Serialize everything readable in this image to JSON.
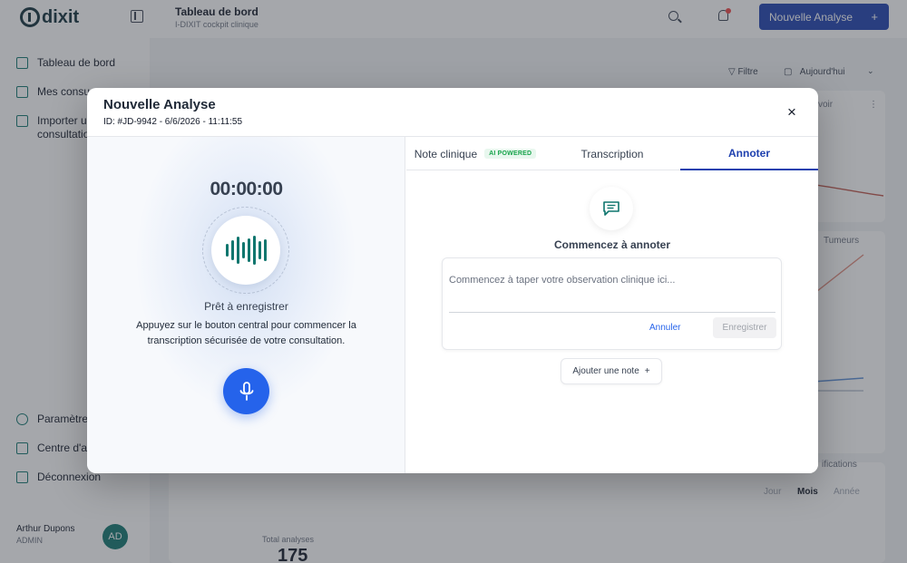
{
  "app": {
    "logo": "dixit",
    "header": {
      "title": "Tableau de bord",
      "subtitle": "I-DIXIT cockpit clinique"
    },
    "new_button": {
      "label": "Nouvelle Analyse",
      "plus": "+"
    },
    "accent_color": "#1e40af",
    "sidebar": {
      "items": [
        {
          "label": "Tableau de bord",
          "icon": "dashboard-icon"
        },
        {
          "label": "Mes consu",
          "icon": "calendar-icon"
        },
        {
          "label": "Importer u\nconsultatio",
          "icon": "upload-file-icon"
        }
      ],
      "bottom_items": [
        {
          "label": "Paramètre",
          "icon": "gear-icon"
        },
        {
          "label": "Centre d'a",
          "icon": "help-icon"
        },
        {
          "label": "Déconnexion",
          "icon": "logout-icon"
        }
      ],
      "user": {
        "name": "Arthur Dupons",
        "role": "ADMIN",
        "initials": "AD"
      }
    },
    "main": {
      "filter_label": "Filtre",
      "date_filter": "Aujourd'hui",
      "card_fragment": "voir",
      "legend_fragment": "Tumeurs",
      "card2_fragment": "ifications",
      "period_segments": [
        "Jour",
        "Mois",
        "Année"
      ],
      "total_label": "Total analyses",
      "total_value": "175"
    }
  },
  "modal": {
    "title": "Nouvelle Analyse",
    "id_line": "ID: #JD-9942 - 6/6/2026 - 11:11:55",
    "close_glyph": "×",
    "recorder": {
      "timer": "00:00:00",
      "status": "Prêt à enregistrer",
      "instructions": "Appuyez sur le bouton central pour commencer la transcription sécurisée de votre consultation."
    },
    "tabs": [
      {
        "label": "Note clinique",
        "badge": "AI POWERED"
      },
      {
        "label": "Transcription"
      },
      {
        "label": "Annoter",
        "active": true
      }
    ],
    "annotate": {
      "heading": "Commencez à annoter",
      "placeholder": "Commencez à taper votre observation clinique ici...",
      "value": "",
      "cancel_label": "Annuler",
      "save_label": "Enregistrer",
      "add_note_label": "Ajouter une note",
      "add_note_plus": "+"
    }
  }
}
